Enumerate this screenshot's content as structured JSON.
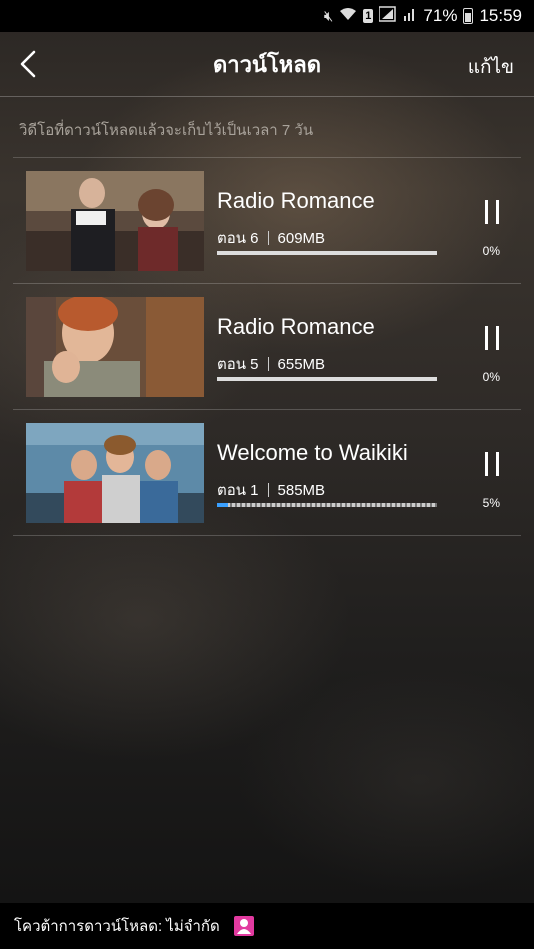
{
  "status_bar": {
    "battery_percent": "71%",
    "time": "15:59",
    "sim_label": "1",
    "icons": [
      "mute-icon",
      "wifi-icon",
      "sim-icon",
      "signal-icon",
      "battery-icon"
    ]
  },
  "header": {
    "title": "ดาวน์โหลด",
    "edit_label": "แก้ไข"
  },
  "notice": "วิดีโอที่ดาวน์โหลดแล้วจะเก็บไว้เป็นเวลา 7 วัน",
  "downloads": [
    {
      "title": "Radio Romance",
      "episode": "ตอน 6",
      "size": "609MB",
      "percent": "0%",
      "progress": 0.0
    },
    {
      "title": "Radio Romance",
      "episode": "ตอน 5",
      "size": "655MB",
      "percent": "0%",
      "progress": 0.0
    },
    {
      "title": "Welcome to Waikiki",
      "episode": "ตอน 1",
      "size": "585MB",
      "percent": "5%",
      "progress": 0.05
    }
  ],
  "footer": {
    "quota_label": "โควต้าการดาวน์โหลด: ไม่จำกัด"
  },
  "colors": {
    "accent_progress": "#3aa0ff",
    "user_badge": "#e23aa0"
  }
}
